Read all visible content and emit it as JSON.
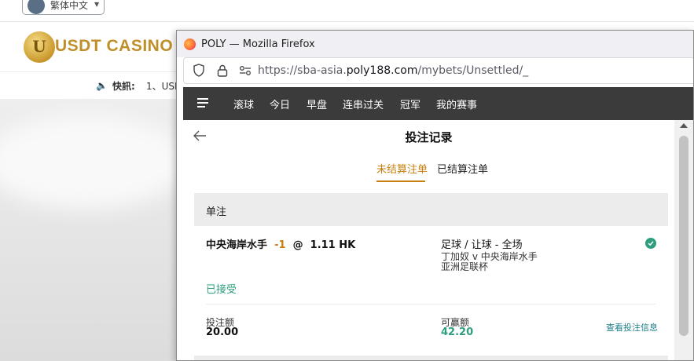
{
  "background_site": {
    "language_label": "繁体中文",
    "logo_letter": "U",
    "logo_text": "USDT CASINO",
    "news_label": "快訊:",
    "news_text": "1、USI"
  },
  "browser": {
    "window_title": "POLY — Mozilla Firefox",
    "url_prefix": "https://sba-asia.",
    "url_domain": "poly188.com",
    "url_path": "/mybets/Unsettled/_"
  },
  "nav": {
    "items": [
      "滚球",
      "今日",
      "早盘",
      "连串过关",
      "冠军",
      "我的赛事"
    ]
  },
  "page": {
    "title": "投注记录",
    "tabs": {
      "unsettled": "未结算注单",
      "settled": "已结算注单"
    }
  },
  "bet": {
    "section": "单注",
    "selection": "中央海岸水手",
    "handicap": "-1",
    "at": "@",
    "odds": "1.11 HK",
    "market": "足球 / 让球 - 全场",
    "match": "丁加奴 v 中央海岸水手",
    "league": "亚洲足联杯",
    "status": "已接受",
    "stake_label": "投注额",
    "stake": "20.00",
    "win_label": "可赢额",
    "win": "42.20",
    "detail_link": "查看投注信息"
  },
  "colors": {
    "accent": "#c77f10",
    "success": "#2e9e7e",
    "nav_bg": "#3b3b3b"
  }
}
